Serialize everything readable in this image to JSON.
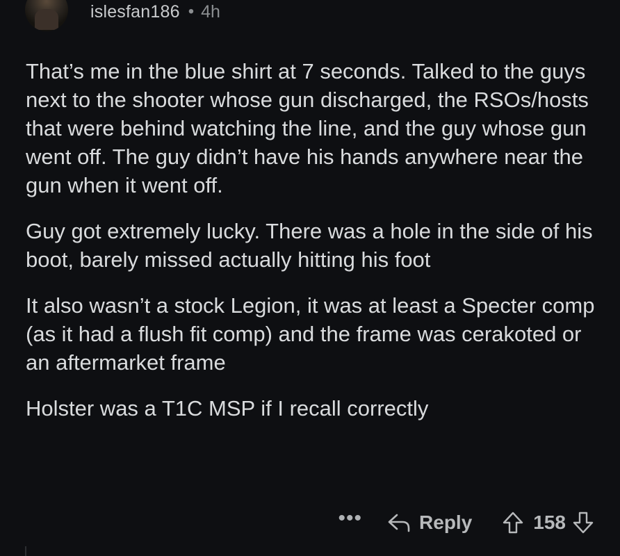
{
  "comment": {
    "username": "islesfan186",
    "separator": "•",
    "age": "4h",
    "paragraphs": [
      "That’s me in the blue shirt at 7 seconds.  Talked to the guys next to the shooter whose gun discharged, the RSOs/hosts that were behind watching the line, and the guy whose gun went off. The guy didn’t have his hands anywhere near the gun when it went off.",
      "Guy got extremely lucky.  There was a hole in the side of his boot, barely missed actually hitting his foot",
      "It also wasn’t a stock Legion, it was at least a Specter comp (as it had a flush fit comp) and the frame was cerakoted or an aftermarket frame",
      "Holster was a T1C MSP if I recall correctly"
    ],
    "actions": {
      "more_label": "•••",
      "reply_label": "Reply",
      "score": "158"
    }
  },
  "icons": {
    "more": "more-dots-icon",
    "reply": "reply-arrow-icon",
    "upvote": "upvote-arrow-icon",
    "downvote": "downvote-arrow-icon"
  },
  "colors": {
    "background": "#0e0f12",
    "text": "#d9dbdd",
    "muted": "#8b8e91"
  }
}
